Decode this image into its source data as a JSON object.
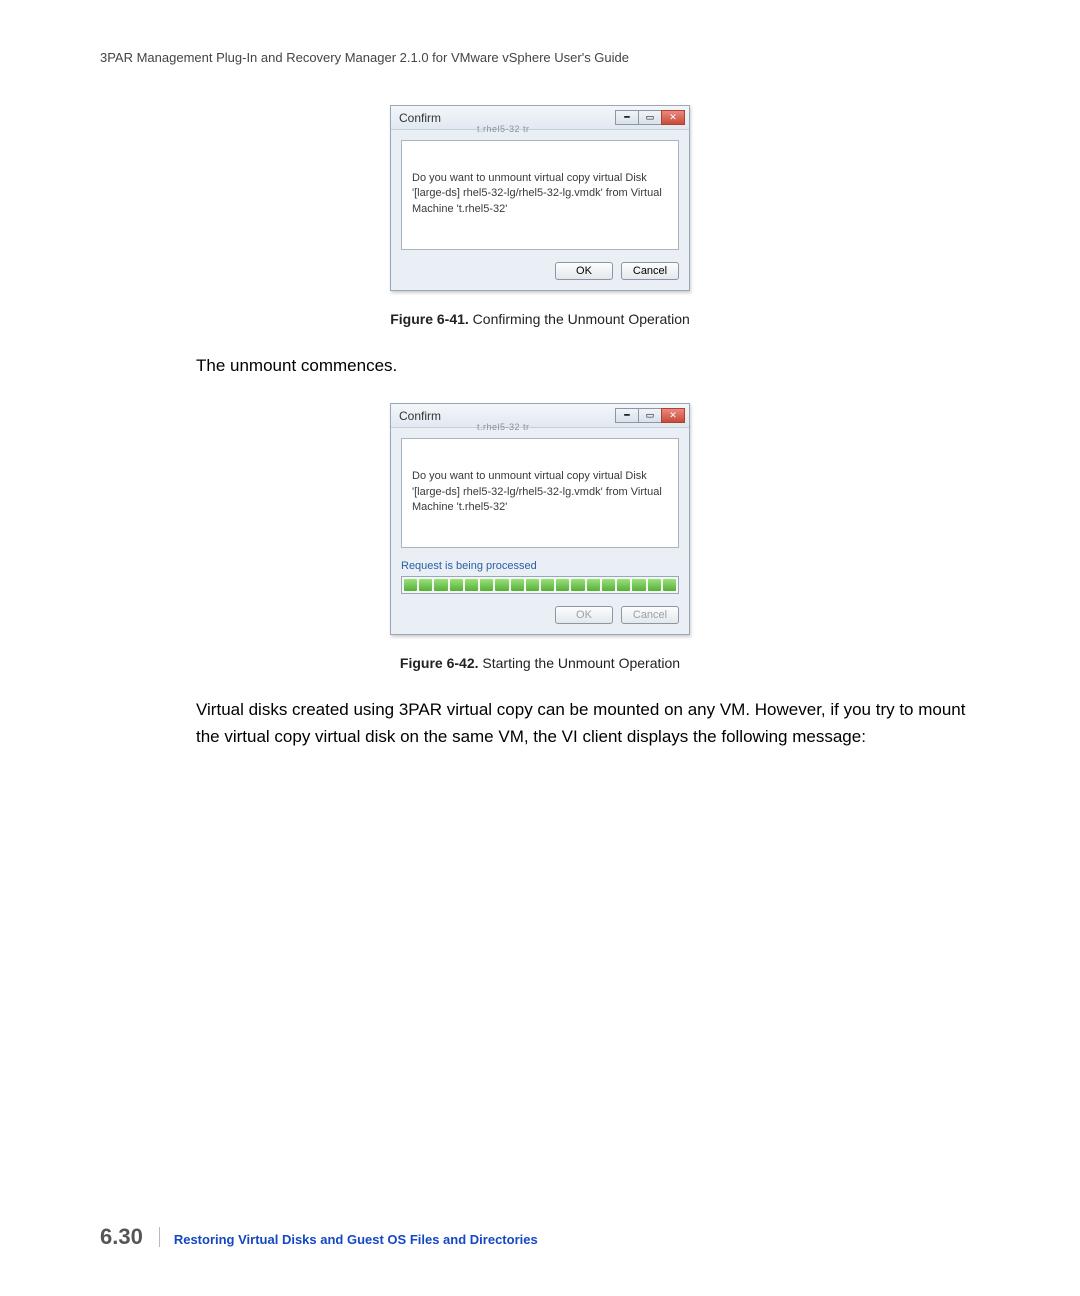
{
  "header": "3PAR Management Plug-In and Recovery Manager 2.1.0 for VMware vSphere User's Guide",
  "dialog1": {
    "title": "Confirm",
    "sub": "t.rhel5-32 tr",
    "message": "Do you want to unmount virtual copy virtual Disk '[large-ds] rhel5-32-lg/rhel5-32-lg.vmdk' from Virtual Machine 't.rhel5-32'",
    "ok": "OK",
    "cancel": "Cancel"
  },
  "caption1": {
    "bold": "Figure 6-41.",
    "rest": "  Confirming the Unmount Operation"
  },
  "para1": "The unmount commences.",
  "dialog2": {
    "title": "Confirm",
    "sub": "t.rhel5-32 tr",
    "message": "Do you want to unmount virtual copy virtual Disk '[large-ds] rhel5-32-lg/rhel5-32-lg.vmdk' from Virtual Machine 't.rhel5-32'",
    "status": "Request is being processed",
    "ok": "OK",
    "cancel": "Cancel"
  },
  "caption2": {
    "bold": "Figure 6-42.",
    "rest": "  Starting the Unmount Operation"
  },
  "para2": "Virtual disks created using 3PAR virtual copy can be mounted on any VM. However, if you try to mount the virtual copy virtual disk on the same VM, the VI client displays the following message:",
  "footer": {
    "page": "6.30",
    "title": "Restoring Virtual Disks and Guest OS Files and Directories"
  }
}
